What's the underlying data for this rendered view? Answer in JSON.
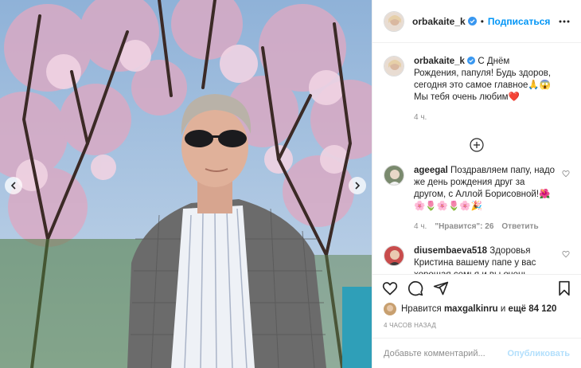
{
  "post": {
    "author": "orbakaite_k",
    "dot": "•",
    "follow_label": "Подписаться",
    "caption": {
      "username": "orbakaite_k",
      "text": "С Днём Рождения, папуля! Будь здоров, сегодня это самое главное🙏😱 Мы тебя очень любим❤️",
      "time": "4 ч."
    },
    "comments": [
      {
        "username": "ageegal",
        "text": "Поздравляем папу, надо же день рождения друг за другом, с Аллой Борисовной!🌺🌸🌷🌸🌷🌸🎉",
        "time": "4 ч.",
        "likes": "\"Нравится\": 26",
        "reply": "Ответить"
      },
      {
        "username": "diusembaeva518",
        "text": "Здоровья Кристина вашему папе у вас хорошая семья и вы очень"
      }
    ],
    "likes": {
      "prefix": "Нравится",
      "user": "maxgalkinru",
      "middle": "и",
      "more": "ещё 84 120"
    },
    "timestamp": "4 ЧАСОВ НАЗАД",
    "add_comment": {
      "placeholder": "Добавьте комментарий...",
      "publish_label": "Опубликовать"
    }
  },
  "colors": {
    "accent": "#0095f6",
    "verified": "#3897f0",
    "publish_disabled": "#b2dffc",
    "muted": "#8e8e8e"
  },
  "icons": [
    "chevron-left-icon",
    "chevron-right-icon",
    "verified-icon",
    "more-icon",
    "load-more-icon",
    "heart-icon",
    "comment-icon",
    "share-icon",
    "bookmark-icon"
  ]
}
